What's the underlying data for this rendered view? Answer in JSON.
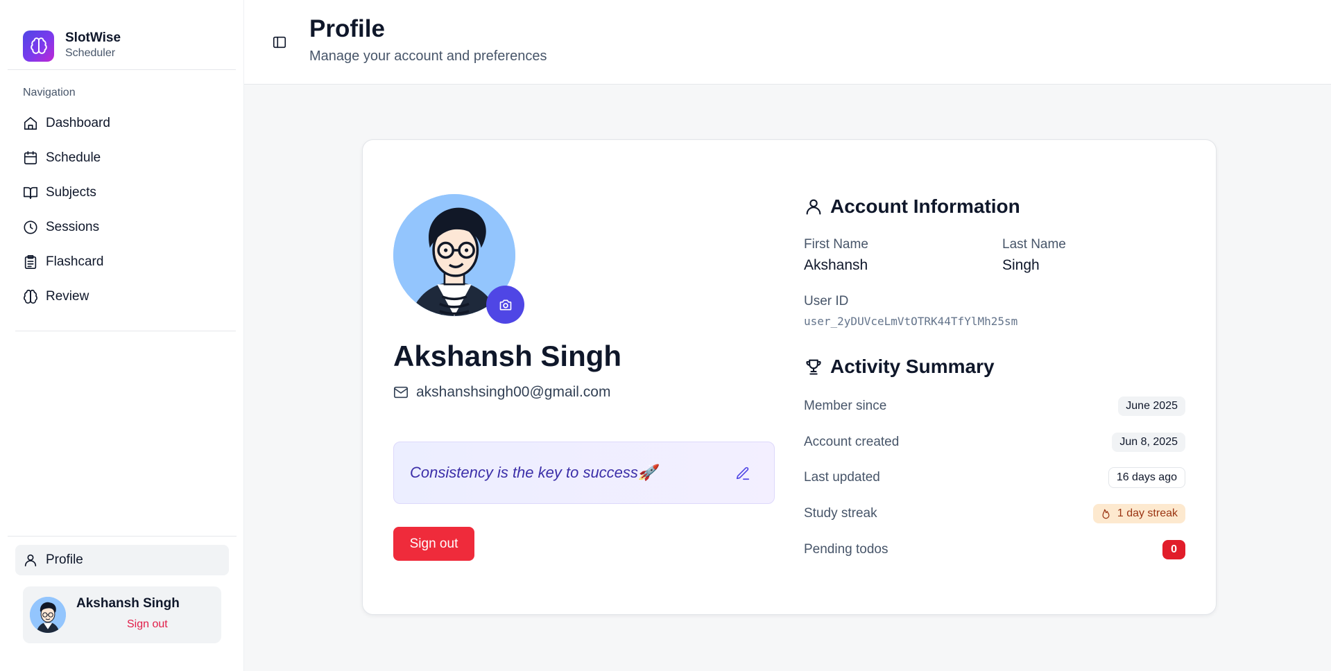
{
  "brand": {
    "name": "SlotWise",
    "subtitle": "Scheduler"
  },
  "sidebar": {
    "nav_label": "Navigation",
    "items": [
      {
        "label": "Dashboard",
        "icon": "home-icon"
      },
      {
        "label": "Schedule",
        "icon": "calendar-icon"
      },
      {
        "label": "Subjects",
        "icon": "book-icon"
      },
      {
        "label": "Sessions",
        "icon": "clock-icon"
      },
      {
        "label": "Flashcard",
        "icon": "clipboard-icon"
      },
      {
        "label": "Review",
        "icon": "brain-icon"
      }
    ],
    "profile_label": "Profile",
    "user": {
      "name": "Akshansh Singh",
      "signout": "Sign out"
    }
  },
  "header": {
    "title": "Profile",
    "subtitle": "Manage your account and preferences"
  },
  "profile": {
    "full_name": "Akshansh Singh",
    "email": "akshanshsingh00@gmail.com",
    "quote": "Consistency is the key to success🚀",
    "signout_label": "Sign out"
  },
  "account": {
    "title": "Account Information",
    "first_name_label": "First Name",
    "first_name": "Akshansh",
    "last_name_label": "Last Name",
    "last_name": "Singh",
    "user_id_label": "User ID",
    "user_id": "user_2yDUVceLmVtOTRK44TfYlMh25sm"
  },
  "activity": {
    "title": "Activity Summary",
    "rows": [
      {
        "label": "Member since",
        "value": "June 2025"
      },
      {
        "label": "Account created",
        "value": "Jun 8, 2025"
      },
      {
        "label": "Last updated",
        "value": "16 days ago"
      },
      {
        "label": "Study streak",
        "value": "1 day streak"
      },
      {
        "label": "Pending todos",
        "value": "0"
      }
    ]
  },
  "colors": {
    "accent": "#4f46e5",
    "danger": "#ef2b3b",
    "streak_bg": "#fde9cf"
  }
}
